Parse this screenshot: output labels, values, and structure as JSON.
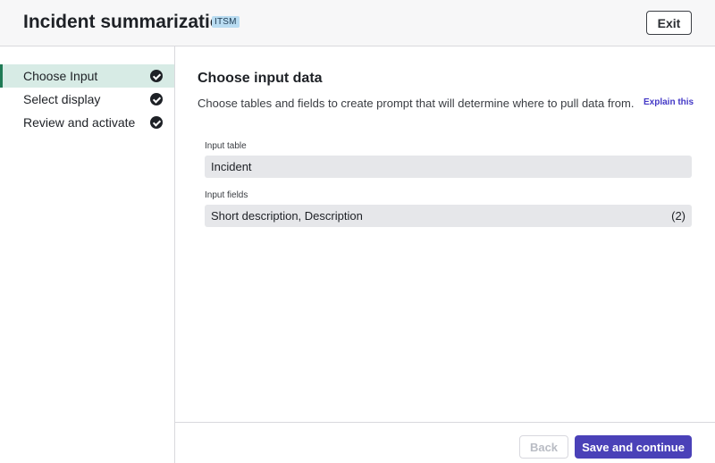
{
  "header": {
    "title": "Incident summarization",
    "badge": "ITSM",
    "exit_label": "Exit"
  },
  "sidebar": {
    "items": [
      {
        "label": "Choose Input",
        "active": true,
        "completed": true
      },
      {
        "label": "Select display",
        "active": false,
        "completed": true
      },
      {
        "label": "Review and activate",
        "active": false,
        "completed": true
      }
    ]
  },
  "main": {
    "title": "Choose input data",
    "description": "Choose tables and fields to create prompt that will determine where to pull data from.",
    "explain_link": "Explain this",
    "input_table": {
      "label": "Input table",
      "value": "Incident"
    },
    "input_fields": {
      "label": "Input fields",
      "value": "Short description, Description",
      "count": "(2)"
    }
  },
  "footer": {
    "back_label": "Back",
    "back_disabled": true,
    "save_label": "Save and continue"
  },
  "colors": {
    "accent": "#4a41b8",
    "active_bg": "#d7ebe5",
    "active_border": "#1f7a55",
    "badge_bg": "#b9dcf1"
  },
  "icons": {
    "step_completed": "check-circle-icon"
  }
}
